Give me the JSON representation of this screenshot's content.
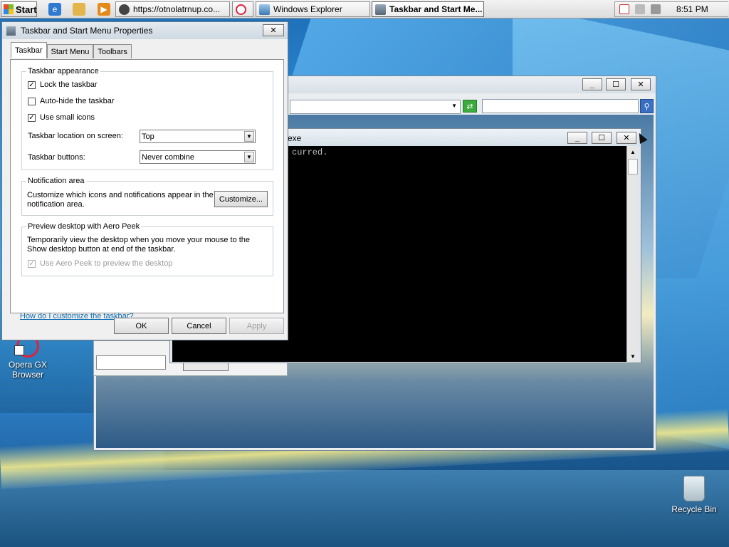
{
  "taskbar": {
    "start_label": "Start",
    "quick_launch": [
      "internet-explorer-icon",
      "folder-icon",
      "media-player-icon"
    ],
    "tasks": [
      {
        "label": "https://otnolatrnup.co...",
        "icon": "browser-icon"
      },
      {
        "label": "",
        "icon": "opera-icon"
      },
      {
        "label": "Windows Explorer",
        "icon": "explorer-icon"
      },
      {
        "label": "Taskbar and Start Me...",
        "icon": "properties-icon",
        "active": true
      }
    ],
    "tray_icons": [
      "network-warning-icon",
      "action-center-icon",
      "volume-icon"
    ],
    "clock": "8:51 PM"
  },
  "dialog": {
    "title": "Taskbar and Start Menu Properties",
    "close_glyph": "✕",
    "tabs": [
      "Taskbar",
      "Start Menu",
      "Toolbars"
    ],
    "appearance": {
      "legend": "Taskbar appearance",
      "lock_label": "Lock the taskbar",
      "lock_checked": true,
      "autohide_label": "Auto-hide the taskbar",
      "autohide_checked": false,
      "small_icons_label": "Use small icons",
      "small_icons_checked": true,
      "location_label": "Taskbar location on screen:",
      "location_value": "Top",
      "buttons_label": "Taskbar buttons:",
      "buttons_value": "Never combine"
    },
    "notification": {
      "legend": "Notification area",
      "text": "Customize which icons and notifications appear in the notification area.",
      "customize_label": "Customize..."
    },
    "peek": {
      "legend": "Preview desktop with Aero Peek",
      "text": "Temporarily view the desktop when you move your mouse to the Show desktop button at end of the taskbar.",
      "checkbox_label": "Use Aero Peek to preview the desktop",
      "checked": true
    },
    "help_link": "How do I customize the taskbar?",
    "ok_label": "OK",
    "cancel_label": "Cancel",
    "apply_label": "Apply"
  },
  "console": {
    "title_fragment": "exe",
    "text": "curred."
  },
  "desktop_icons": {
    "opera_label": "Opera GX Browser",
    "recycle_label": "Recycle Bin"
  },
  "glyphs": {
    "minimize": "_",
    "maximize": "☐",
    "close": "✕",
    "check": "✓",
    "dropdown": "▼",
    "up": "▲",
    "down": "▼"
  }
}
